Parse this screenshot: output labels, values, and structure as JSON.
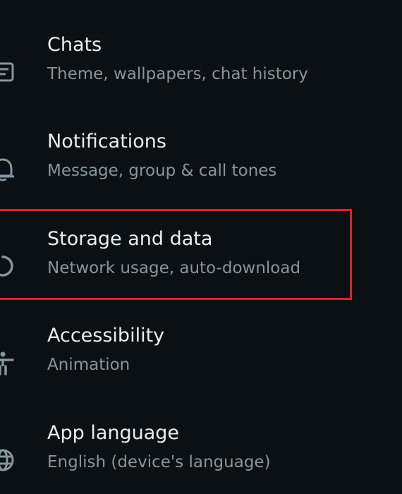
{
  "settings": {
    "items": [
      {
        "id": "chats",
        "title": "Chats",
        "subtitle": "Theme, wallpapers, chat history",
        "icon": "chat-icon"
      },
      {
        "id": "notifications",
        "title": "Notifications",
        "subtitle": "Message, group & call tones",
        "icon": "bell-icon"
      },
      {
        "id": "storage",
        "title": "Storage and data",
        "subtitle": "Network usage, auto-download",
        "icon": "storage-circle-icon"
      },
      {
        "id": "accessibility",
        "title": "Accessibility",
        "subtitle": "Animation",
        "icon": "accessibility-icon"
      },
      {
        "id": "language",
        "title": "App language",
        "subtitle": "English (device's language)",
        "icon": "globe-icon"
      }
    ]
  },
  "colors": {
    "background": "#0b1014",
    "title": "#e9edef",
    "subtitle": "#8696a0",
    "highlight": "#d3262c"
  }
}
